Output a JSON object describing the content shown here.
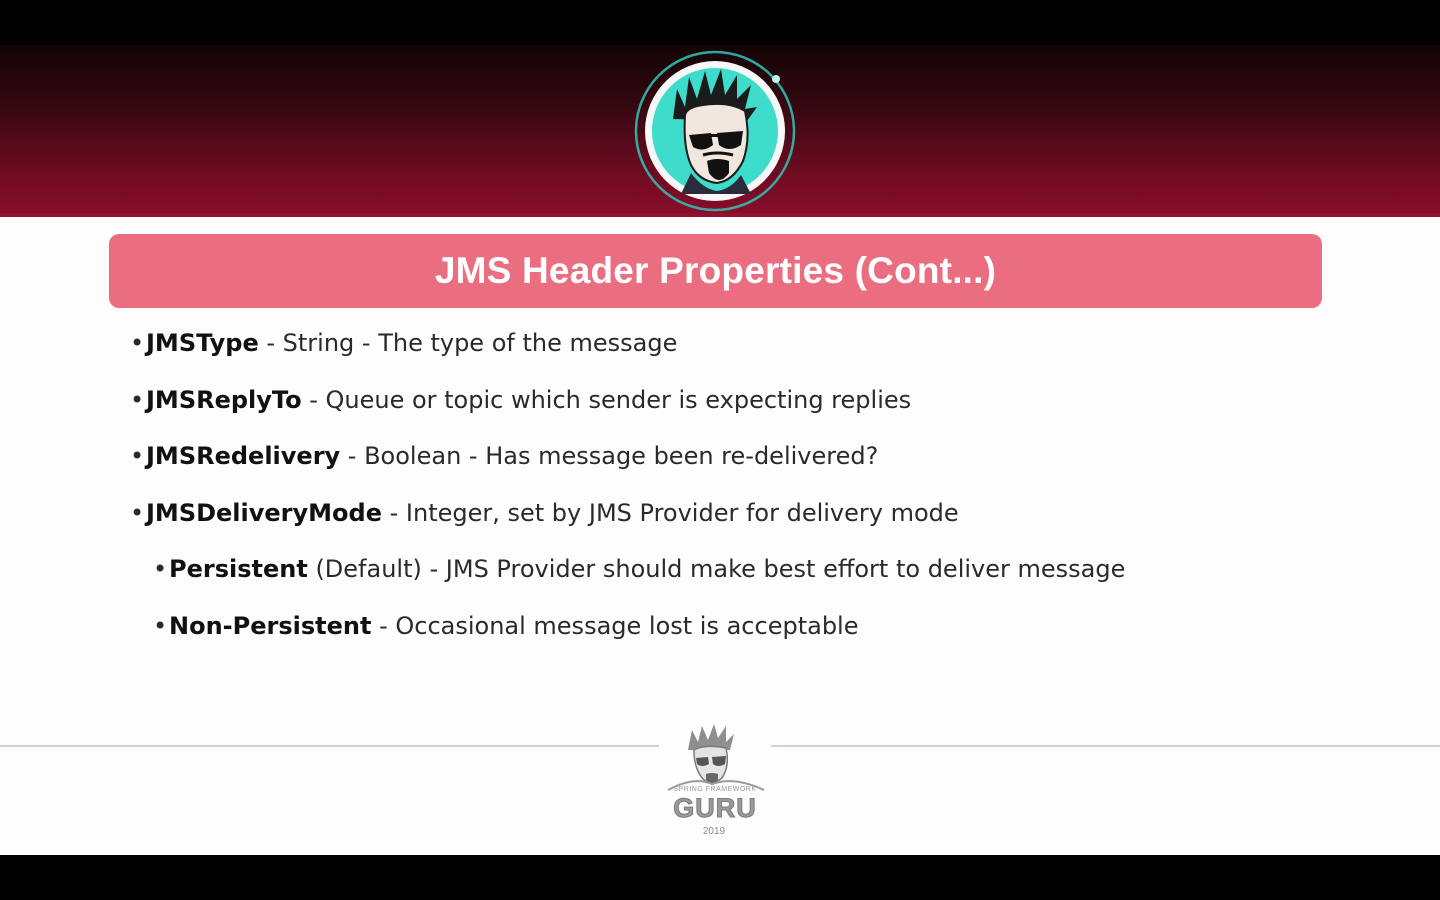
{
  "slide": {
    "title": "JMS Header Properties (Cont...)",
    "bullets": [
      {
        "term": "JMSType",
        "desc": " - String - The type of the message",
        "level": 1
      },
      {
        "term": "JMSReplyTo",
        "desc": " - Queue or topic which sender is expecting replies",
        "level": 1
      },
      {
        "term": "JMSRedelivery",
        "desc": " - Boolean - Has message been re-delivered?",
        "level": 1
      },
      {
        "term": "JMSDeliveryMode",
        "desc": " - Integer, set by JMS Provider for delivery mode",
        "level": 1
      },
      {
        "term": "Persistent",
        "desc": " (Default) - JMS Provider should make best effort to deliver message",
        "level": 2
      },
      {
        "term": "Non-Persistent",
        "desc": " - Occasional message lost is acceptable",
        "level": 2
      }
    ],
    "bullet_symbol": "•"
  },
  "footer": {
    "logo_small": "SPRING FRAMEWORK",
    "logo_word": "GURU",
    "year": "2019"
  },
  "colors": {
    "banner_dark": "#120405",
    "banner_red": "#8a0d2a",
    "title_bar": "#ea6e80",
    "avatar_ring": "#2fc7b8",
    "avatar_bg": "#3ddccb"
  },
  "icons": {
    "avatar": "guru-avatar-icon",
    "footer_logo": "spring-framework-guru-logo"
  }
}
